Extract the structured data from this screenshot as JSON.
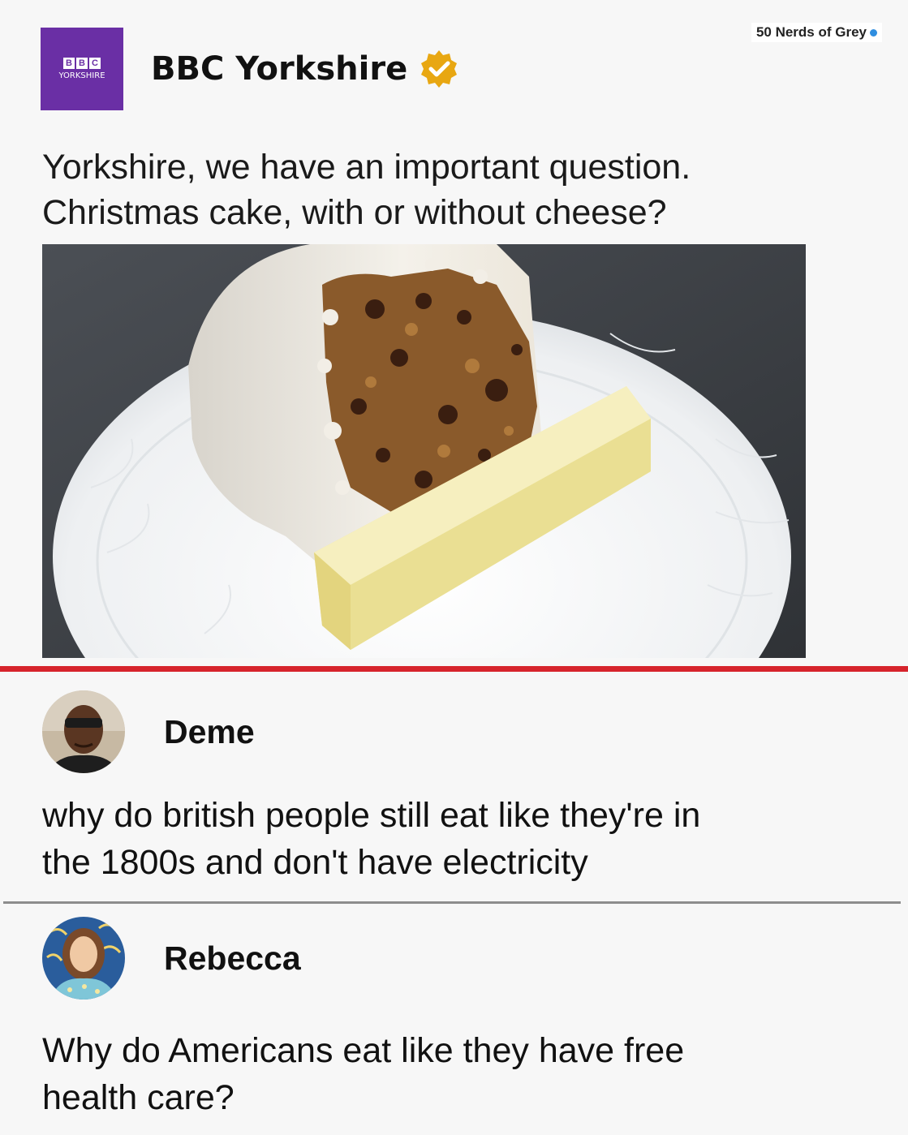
{
  "watermark": {
    "text": "50 Nerds of Grey"
  },
  "post": {
    "logo": {
      "letters": [
        "B",
        "B",
        "C"
      ],
      "subtitle": "YORKSHIRE"
    },
    "account_name": "BBC Yorkshire",
    "verified_icon": "verified-badge-icon",
    "text_line1": "Yorkshire, we have an important question.",
    "text_line2": "Christmas cake, with or without cheese?"
  },
  "comments": [
    {
      "name": "Deme",
      "text_line1": "why do british people still eat like they're in",
      "text_line2": "the 1800s and don't have electricity"
    },
    {
      "name": "Rebecca",
      "text_line1": "Why do Americans eat like they have free",
      "text_line2": "health care?"
    }
  ],
  "colors": {
    "brand_purple": "#6a2fa5",
    "verified_gold": "#e8a712",
    "divider_red": "#d6242c",
    "divider_gray": "#8d8d8d"
  }
}
